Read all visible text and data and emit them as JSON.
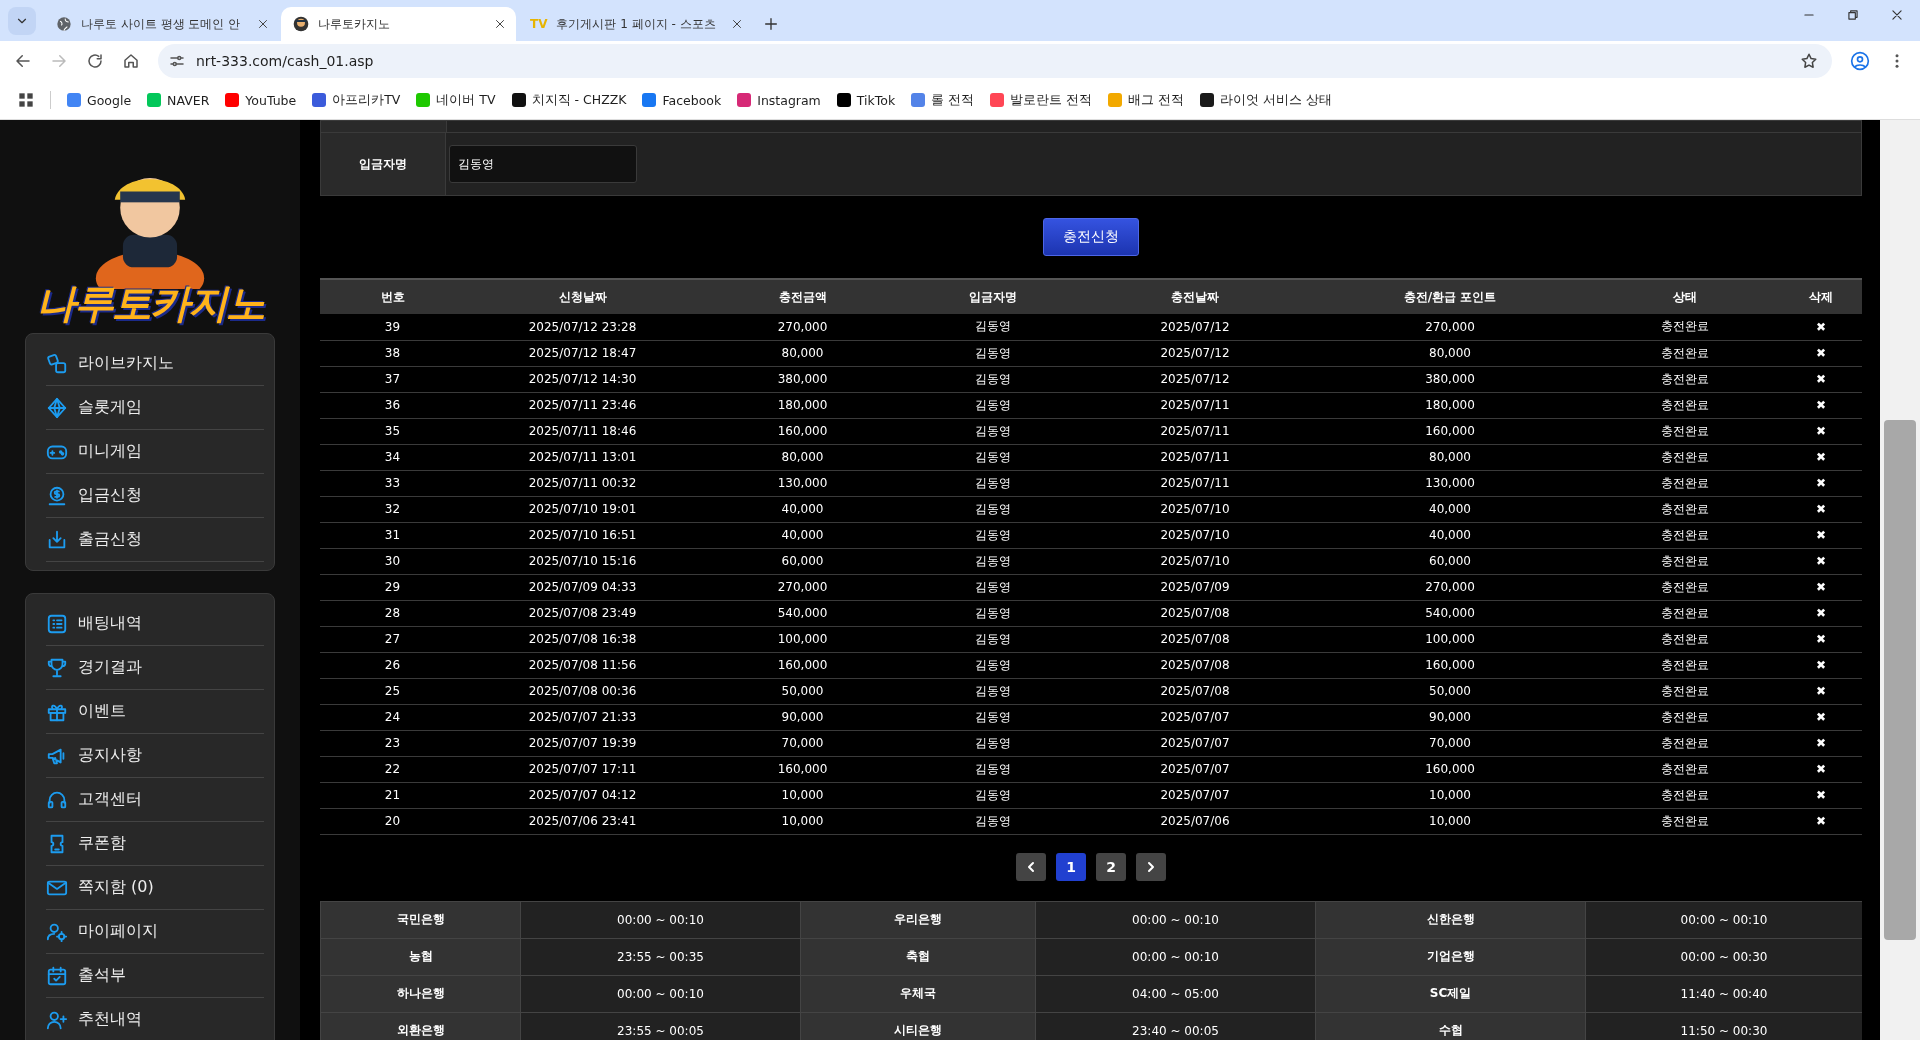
{
  "browser": {
    "tabs": [
      {
        "title": "나루토 사이트 평생 도메인 안",
        "selected": false
      },
      {
        "title": "나루토카지노",
        "selected": true
      },
      {
        "title": "후기게시판 1 페이지 - 스포츠",
        "favicon": "TV",
        "selected": false
      }
    ],
    "url": "nrt-333.com/cash_01.asp",
    "bookmarks": [
      {
        "label": "Google",
        "color": "#4285f4"
      },
      {
        "label": "NAVER",
        "color": "#03c75a"
      },
      {
        "label": "YouTube",
        "color": "#ff0000"
      },
      {
        "label": "아프리카TV",
        "color": "#3b5bdb"
      },
      {
        "label": "네이버 TV",
        "color": "#1ec800"
      },
      {
        "label": "치지직 - CHZZK",
        "color": "#111111"
      },
      {
        "label": "Facebook",
        "color": "#1877f2"
      },
      {
        "label": "Instagram",
        "color": "#d62976"
      },
      {
        "label": "TikTok",
        "color": "#000000"
      },
      {
        "label": "롤 전적",
        "color": "#5383e8"
      },
      {
        "label": "발로란트 전적",
        "color": "#ff4655"
      },
      {
        "label": "배그 전적",
        "color": "#f2a900"
      },
      {
        "label": "라이엇 서비스 상태",
        "color": "#1a1a1a"
      }
    ]
  },
  "sidebar": {
    "logo": "나루토카지노",
    "groups": [
      {
        "items": [
          {
            "label": "라이브카지노"
          },
          {
            "label": "슬롯게임"
          },
          {
            "label": "미니게임"
          },
          {
            "label": "입금신청"
          },
          {
            "label": "출금신청"
          }
        ]
      },
      {
        "items": [
          {
            "label": "배팅내역"
          },
          {
            "label": "경기결과"
          },
          {
            "label": "이벤트"
          },
          {
            "label": "공지사항"
          },
          {
            "label": "고객센터"
          },
          {
            "label": "쿠폰함"
          },
          {
            "label": "쪽지함 (0)"
          },
          {
            "label": "마이페이지"
          },
          {
            "label": "출석부"
          },
          {
            "label": "추천내역"
          }
        ]
      }
    ]
  },
  "form": {
    "depositor_label": "입금자명",
    "depositor_value": "김동영",
    "submit": "충전신청"
  },
  "table": {
    "columns": [
      "번호",
      "신청날짜",
      "충전금액",
      "입금자명",
      "충전날짜",
      "충전/환급 포인트",
      "상태",
      "삭제"
    ],
    "rows": [
      [
        "39",
        "2025/07/12 23:28",
        "270,000",
        "김동영",
        "2025/07/12",
        "270,000",
        "충전완료",
        "✖"
      ],
      [
        "38",
        "2025/07/12 18:47",
        "80,000",
        "김동영",
        "2025/07/12",
        "80,000",
        "충전완료",
        "✖"
      ],
      [
        "37",
        "2025/07/12 14:30",
        "380,000",
        "김동영",
        "2025/07/12",
        "380,000",
        "충전완료",
        "✖"
      ],
      [
        "36",
        "2025/07/11 23:46",
        "180,000",
        "김동영",
        "2025/07/11",
        "180,000",
        "충전완료",
        "✖"
      ],
      [
        "35",
        "2025/07/11 18:46",
        "160,000",
        "김동영",
        "2025/07/11",
        "160,000",
        "충전완료",
        "✖"
      ],
      [
        "34",
        "2025/07/11 13:01",
        "80,000",
        "김동영",
        "2025/07/11",
        "80,000",
        "충전완료",
        "✖"
      ],
      [
        "33",
        "2025/07/11 00:32",
        "130,000",
        "김동영",
        "2025/07/11",
        "130,000",
        "충전완료",
        "✖"
      ],
      [
        "32",
        "2025/07/10 19:01",
        "40,000",
        "김동영",
        "2025/07/10",
        "40,000",
        "충전완료",
        "✖"
      ],
      [
        "31",
        "2025/07/10 16:51",
        "40,000",
        "김동영",
        "2025/07/10",
        "40,000",
        "충전완료",
        "✖"
      ],
      [
        "30",
        "2025/07/10 15:16",
        "60,000",
        "김동영",
        "2025/07/10",
        "60,000",
        "충전완료",
        "✖"
      ],
      [
        "29",
        "2025/07/09 04:33",
        "270,000",
        "김동영",
        "2025/07/09",
        "270,000",
        "충전완료",
        "✖"
      ],
      [
        "28",
        "2025/07/08 23:49",
        "540,000",
        "김동영",
        "2025/07/08",
        "540,000",
        "충전완료",
        "✖"
      ],
      [
        "27",
        "2025/07/08 16:38",
        "100,000",
        "김동영",
        "2025/07/08",
        "100,000",
        "충전완료",
        "✖"
      ],
      [
        "26",
        "2025/07/08 11:56",
        "160,000",
        "김동영",
        "2025/07/08",
        "160,000",
        "충전완료",
        "✖"
      ],
      [
        "25",
        "2025/07/08 00:36",
        "50,000",
        "김동영",
        "2025/07/08",
        "50,000",
        "충전완료",
        "✖"
      ],
      [
        "24",
        "2025/07/07 21:33",
        "90,000",
        "김동영",
        "2025/07/07",
        "90,000",
        "충전완료",
        "✖"
      ],
      [
        "23",
        "2025/07/07 19:39",
        "70,000",
        "김동영",
        "2025/07/07",
        "70,000",
        "충전완료",
        "✖"
      ],
      [
        "22",
        "2025/07/07 17:11",
        "160,000",
        "김동영",
        "2025/07/07",
        "160,000",
        "충전완료",
        "✖"
      ],
      [
        "21",
        "2025/07/07 04:12",
        "10,000",
        "김동영",
        "2025/07/07",
        "10,000",
        "충전완료",
        "✖"
      ],
      [
        "20",
        "2025/07/06 23:41",
        "10,000",
        "김동영",
        "2025/07/06",
        "10,000",
        "충전완료",
        "✖"
      ]
    ]
  },
  "pagination": {
    "pages": [
      {
        "label": "1",
        "selected": true
      },
      {
        "label": "2",
        "selected": false
      }
    ]
  },
  "bank_hours": [
    [
      {
        "bank": "국민은행",
        "hours": "00:00 ~ 00:10"
      },
      {
        "bank": "우리은행",
        "hours": "00:00 ~ 00:10"
      },
      {
        "bank": "신한은행",
        "hours": "00:00 ~ 00:10"
      }
    ],
    [
      {
        "bank": "농협",
        "hours": "23:55 ~ 00:35"
      },
      {
        "bank": "축협",
        "hours": "00:00 ~ 00:10"
      },
      {
        "bank": "기업은행",
        "hours": "00:00 ~ 00:30"
      }
    ],
    [
      {
        "bank": "하나은행",
        "hours": "00:00 ~ 00:10"
      },
      {
        "bank": "우체국",
        "hours": "04:00 ~ 05:00"
      },
      {
        "bank": "SC제일",
        "hours": "11:40 ~ 00:40"
      }
    ],
    [
      {
        "bank": "외환은행",
        "hours": "23:55 ~ 00:05"
      },
      {
        "bank": "시티은행",
        "hours": "23:40 ~ 00:05"
      },
      {
        "bank": "수협",
        "hours": "11:50 ~ 00:30"
      }
    ]
  ]
}
